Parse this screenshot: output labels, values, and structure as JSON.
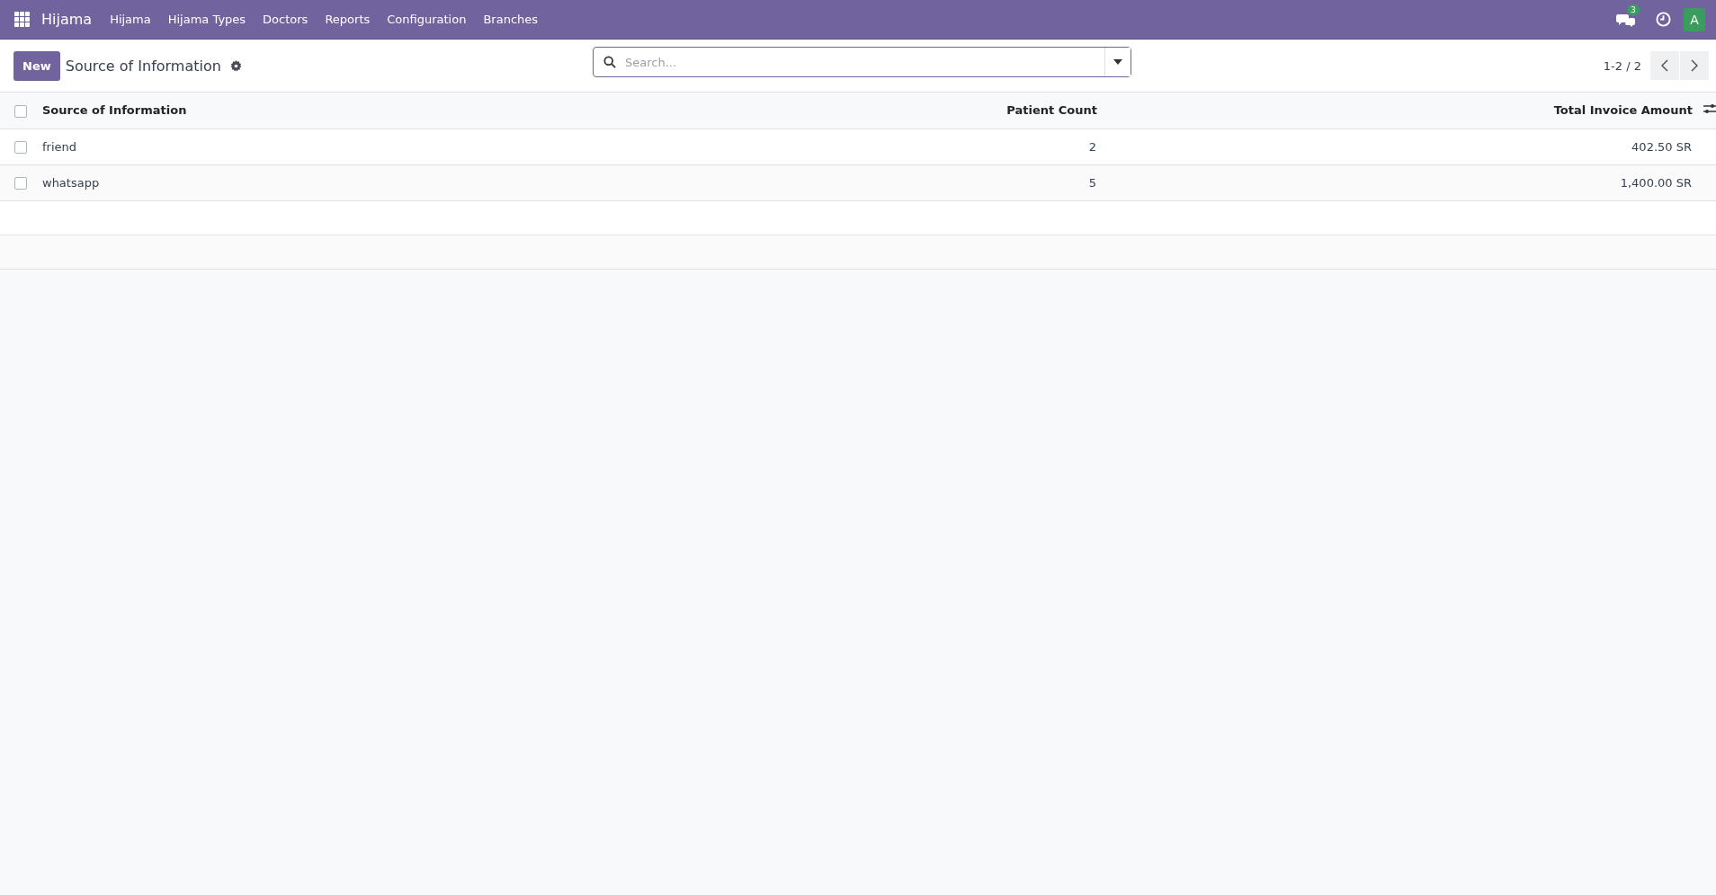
{
  "navbar": {
    "app_name": "Hijama",
    "menu": [
      "Hijama",
      "Hijama Types",
      "Doctors",
      "Reports",
      "Configuration",
      "Branches"
    ],
    "messages_badge": "3",
    "avatar": "A"
  },
  "control_panel": {
    "new_button": "New",
    "title": "Source of Information",
    "search": {
      "placeholder": "Search..."
    },
    "pager": "1-2 / 2"
  },
  "table": {
    "select_all_checked": false,
    "columns": [
      "Source of Information",
      "Patient Count",
      "Total Invoice Amount"
    ],
    "rows": [
      {
        "checked": false,
        "cells": [
          "friend",
          "2",
          "402.50 SR"
        ]
      },
      {
        "checked": false,
        "cells": [
          "whatsapp",
          "5",
          "1,400.00 SR"
        ]
      }
    ]
  }
}
